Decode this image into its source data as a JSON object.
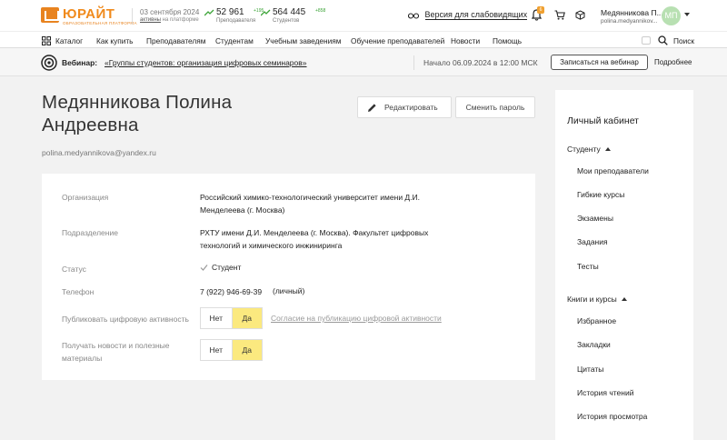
{
  "header": {
    "logo_text": "ЮРАЙТ",
    "logo_subtitle": "ОБРАЗОВАТЕЛЬНАЯ ПЛАТФОРМА",
    "date": "03 сентября 2024",
    "date_sub_link": "активны",
    "date_sub_rest": "на платформе",
    "teachers_count": "52 961",
    "teachers_increment": "+195",
    "teachers_label": "Преподавателя",
    "students_count": "564 445",
    "students_increment": "+858",
    "students_label": "Студентов",
    "vision_label": "Версия для слабовидящих",
    "notifications_badge": "6",
    "user_name": "Медянникова П...",
    "user_email": "polina.medyannikov...",
    "avatar_initials": "МП"
  },
  "nav": {
    "items": [
      "Каталог",
      "Как купить",
      "Преподавателям",
      "Студентам",
      "Учебным заведениям",
      "Обучение преподавателей",
      "Новости",
      "Помощь"
    ],
    "search_label": "Поиск"
  },
  "webinar": {
    "label": "Вебинар:",
    "link": "«Группы студентов: организация цифровых семинаров»",
    "start": "Начало 06.09.2024 в 12:00 МСК",
    "signup_button": "Записаться на вебинар",
    "more": "Подробнее"
  },
  "profile": {
    "name": "Медянникова Полина Андреевна",
    "email": "polina.medyannikova@yandex.ru",
    "edit_button": "Редактировать",
    "change_password_button": "Сменить пароль",
    "fields": {
      "org_label": "Организация",
      "org_value": "Российский химико-технологический университет имени Д.И. Менделеева (г. Москва)",
      "dept_label": "Подразделение",
      "dept_value": "РХТУ имени Д.И. Менделеева (г. Москва). Факультет цифровых технологий и химического инжиниринга",
      "status_label": "Статус",
      "status_value": "Студент",
      "phone_label": "Телефон",
      "phone_value": "7 (922) 946-69-39",
      "phone_type": "(личный)",
      "publish_label": "Публиковать цифровую активность",
      "publish_no": "Нет",
      "publish_yes": "Да",
      "publish_consent": "Согласие на публикацию цифровой активности",
      "news_label": "Получать новости и полезные материалы",
      "news_no": "Нет",
      "news_yes": "Да"
    }
  },
  "sidebar": {
    "title": "Личный кабинет",
    "group_student": "Студенту",
    "student_items": [
      "Мои преподаватели",
      "Гибкие курсы",
      "Экзамены",
      "Задания",
      "Тесты"
    ],
    "group_books": "Книги и курсы",
    "book_items": [
      "Избранное",
      "Закладки",
      "Цитаты",
      "История чтений",
      "История просмотра"
    ]
  },
  "colors": {
    "accent_orange": "#f08a1c",
    "toggle_active": "#fbe97f",
    "stat_green": "#3aa336",
    "avatar_bg": "#b8e0b2"
  }
}
